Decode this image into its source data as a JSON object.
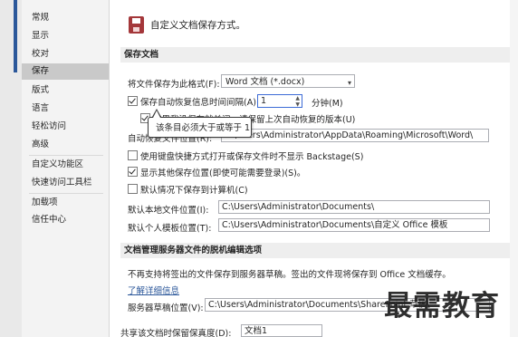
{
  "sidebar": {
    "items": [
      {
        "label": "常规",
        "active": false
      },
      {
        "label": "显示",
        "active": false
      },
      {
        "label": "校对",
        "active": false
      },
      {
        "label": "保存",
        "active": true
      },
      {
        "label": "版式",
        "active": false
      },
      {
        "label": "语言",
        "active": false
      },
      {
        "label": "轻松访问",
        "active": false
      },
      {
        "label": "高级",
        "active": false
      },
      {
        "label": "自定义功能区",
        "active": false
      },
      {
        "label": "快速访问工具栏",
        "active": false
      },
      {
        "label": "加载项",
        "active": false
      },
      {
        "label": "信任中心",
        "active": false
      }
    ]
  },
  "header": {
    "title": "自定义文档保存方式。",
    "icon": "save-floppy-icon"
  },
  "save_section": {
    "title": "保存文档",
    "format_label": "将文件保存为此格式(F):",
    "format_value": "Word 文档 (*.docx)",
    "autorecover_label": "保存自动恢复信息时间间隔(A)",
    "autorecover_value": "1",
    "minutes_label": "分钟(M)",
    "keep_last_label": "如果我没保存就关闭，请保留上次自动恢复的版本(U)",
    "autorecover_location_label": "自动恢复文件位置(R):",
    "autorecover_location_value": "C:\\Users\\Administrator\\AppData\\Roaming\\Microsoft\\Word\\",
    "no_backstage_label": "使用键盘快捷方式打开或保存文件时不显示 Backstage(S)",
    "show_additional_label": "显示其他保存位置(即使可能需要登录)(S)。",
    "default_computer_label": "默认情况下保存到计算机(C)",
    "local_location_label": "默认本地文件位置(I):",
    "local_location_value": "C:\\Users\\Administrator\\Documents\\",
    "template_location_label": "默认个人模板位置(T):",
    "template_location_value": "C:\\Users\\Administrator\\Documents\\自定义 Office 模板"
  },
  "tooltip": {
    "text": "该条目必须大于或等于 1"
  },
  "offline_section": {
    "title": "文档管理服务器文件的脱机编辑选项",
    "description": "不再支持将签出的文件保存到服务器草稿。签出的文件现将保存到 Office 文档缓存。",
    "learn_more": "了解详细信息",
    "drafts_label": "服务器草稿位置(V):",
    "drafts_value": "C:\\Users\\Administrator\\Documents\\SharePoint 草稿\\"
  },
  "bottom_partial": {
    "label": "共享该文档时保留保真度(D):",
    "value": "文档1"
  },
  "watermark": "最需教育",
  "colors": {
    "accent": "#2b579a",
    "save_icon": "#a4373a",
    "sidebar_active": "#c9c9c9"
  }
}
